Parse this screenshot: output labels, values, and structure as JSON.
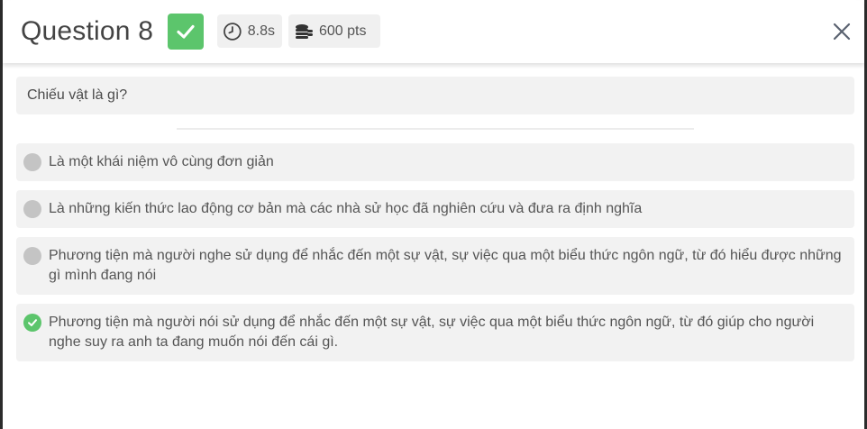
{
  "header": {
    "title": "Question 8",
    "time": "8.8s",
    "points": "600 pts"
  },
  "question": {
    "text": "Chiếu vật là gì?"
  },
  "options": [
    {
      "text": "Là một khái niệm vô cùng đơn giản",
      "correct": false
    },
    {
      "text": "Là những kiến thức lao động cơ bản mà các nhà sử học đã nghiên cứu và đưa ra định nghĩa",
      "correct": false
    },
    {
      "text": "Phương tiện mà người nghe sử dụng để nhắc đến một sự vật, sự việc qua một biểu thức ngôn ngữ, từ đó hiểu được những gì mình đang nói",
      "correct": false
    },
    {
      "text": "Phương tiện mà người nói sử dụng để nhắc đến một sự vật, sự việc qua một biểu thức ngôn ngữ, từ đó giúp cho người nghe suy ra anh ta đang muốn nói đến cái gì.",
      "correct": true
    }
  ],
  "icons": {
    "correct_badge": "check-icon",
    "time": "clock-icon",
    "points": "coins-icon",
    "close": "close-icon",
    "option_unselected": "radio-empty-icon",
    "option_correct": "check-circle-icon"
  },
  "colors": {
    "accent_green": "#5cc56c",
    "neutral_marker": "#c4c4c4",
    "panel_bg": "#f2f2f2"
  }
}
